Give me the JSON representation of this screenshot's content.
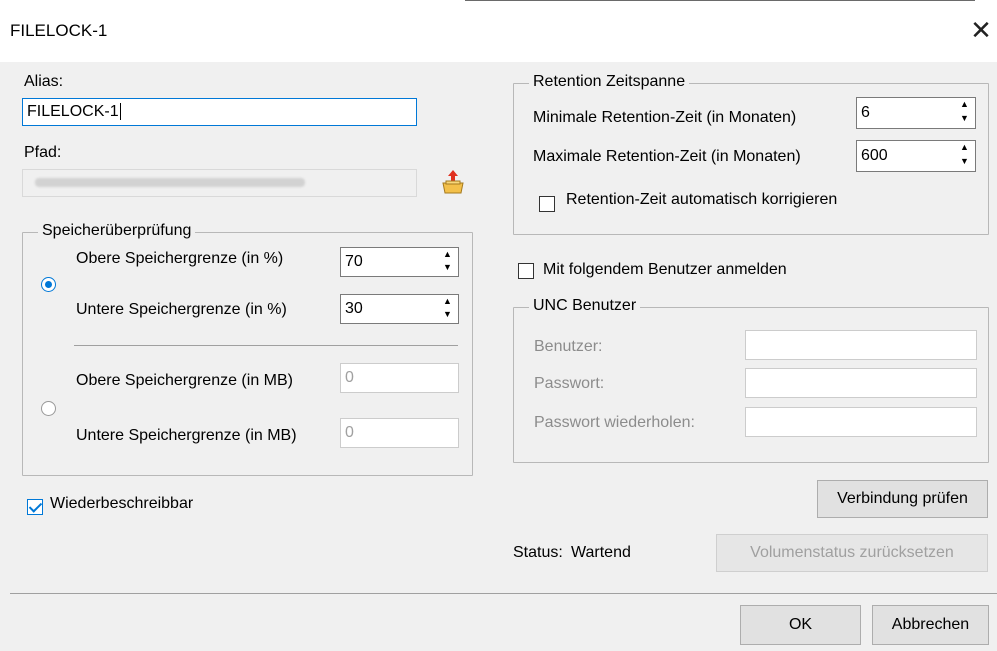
{
  "window": {
    "title": "FILELOCK-1",
    "close_symbol": "✕"
  },
  "alias": {
    "label": "Alias:",
    "value": "FILELOCK-1"
  },
  "path": {
    "label": "Pfad:",
    "value": "",
    "browse_icon": "folder-browse-icon"
  },
  "storage": {
    "legend": "Speicherüberprüfung",
    "upper_percent_label": "Obere Speichergrenze (in %)",
    "upper_percent_value": "70",
    "lower_percent_label": "Untere Speichergrenze (in %)",
    "lower_percent_value": "30",
    "upper_mb_label": "Obere Speichergrenze (in MB)",
    "upper_mb_value": "0",
    "lower_mb_label": "Untere Speichergrenze (in MB)",
    "lower_mb_value": "0"
  },
  "rewritable": {
    "label": "Wiederbeschreibbar",
    "checked": true
  },
  "retention": {
    "legend": "Retention Zeitspanne",
    "min_label": "Minimale Retention-Zeit (in Monaten)",
    "min_value": "6",
    "max_label": "Maximale Retention-Zeit (in Monaten)",
    "max_value": "600",
    "auto_label": "Retention-Zeit automatisch korrigieren"
  },
  "login": {
    "label": "Mit folgendem Benutzer anmelden",
    "checked": false
  },
  "unc": {
    "legend": "UNC Benutzer",
    "user_label": "Benutzer:",
    "password_label": "Passwort:",
    "password_repeat_label": "Passwort wiederholen:"
  },
  "buttons": {
    "check_connection": "Verbindung prüfen",
    "reset_volume_status": "Volumenstatus zurücksetzen",
    "ok": "OK",
    "cancel": "Abbrechen"
  },
  "status": {
    "label": "Status:",
    "value": "Wartend"
  },
  "colors": {
    "accent": "#0078d7",
    "dialog_bg": "#f0f0f0",
    "title_bg": "#ffffff"
  }
}
